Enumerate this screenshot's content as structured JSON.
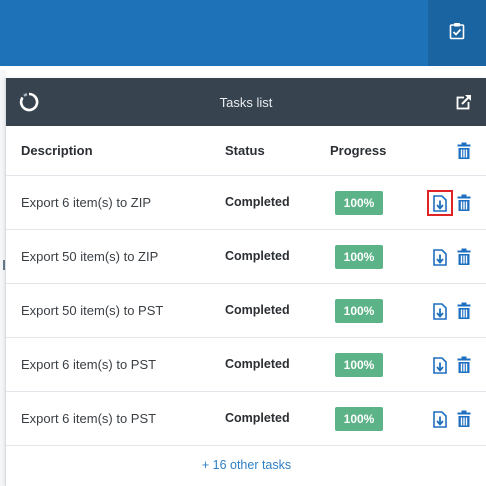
{
  "topbar": {
    "tasks_icon": "clipboard-check-icon"
  },
  "panel": {
    "title": "Tasks list",
    "left_icon": "spinner-ring-icon",
    "right_icon": "open-external-icon"
  },
  "table": {
    "headers": {
      "description": "Description",
      "status": "Status",
      "progress": "Progress"
    },
    "rows": [
      {
        "description": "Export 6 item(s) to ZIP",
        "status": "Completed",
        "progress": "100%"
      },
      {
        "description": "Export 50 item(s) to ZIP",
        "status": "Completed",
        "progress": "100%"
      },
      {
        "description": "Export 50 item(s) to PST",
        "status": "Completed",
        "progress": "100%"
      },
      {
        "description": "Export 6 item(s) to PST",
        "status": "Completed",
        "progress": "100%"
      },
      {
        "description": "Export 6 item(s) to PST",
        "status": "Completed",
        "progress": "100%"
      }
    ]
  },
  "footer": {
    "more_link": "+ 16 other tasks"
  },
  "colors": {
    "topbar": "#1e73b8",
    "panel_header": "#37434f",
    "badge": "#5cb387",
    "icon_blue": "#1f6fc0",
    "highlight": "#e02424",
    "link": "#2f7fc4"
  }
}
